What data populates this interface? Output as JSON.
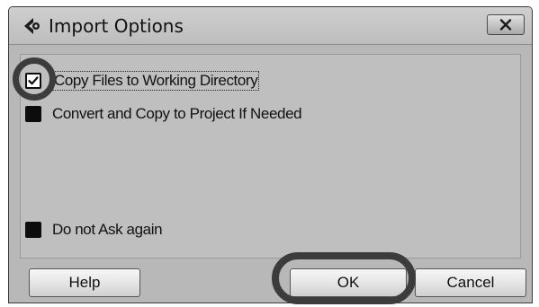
{
  "dialog": {
    "title": "Import Options",
    "app_icon": "cubase-logo-icon",
    "close_icon": "close-icon"
  },
  "options": [
    {
      "label": "Copy Files to Working Directory",
      "checked": true
    },
    {
      "label": "Convert and Copy to Project If Needed",
      "checked": false
    },
    {
      "label": "Do not Ask again",
      "checked": false
    }
  ],
  "buttons": {
    "help_label": "Help",
    "ok_label": "OK",
    "cancel_label": "Cancel"
  },
  "colors": {
    "window_bg": "#b8b8b8",
    "checkbox": "#0d0d0d",
    "highlight_ring": "#3c3c3c"
  }
}
